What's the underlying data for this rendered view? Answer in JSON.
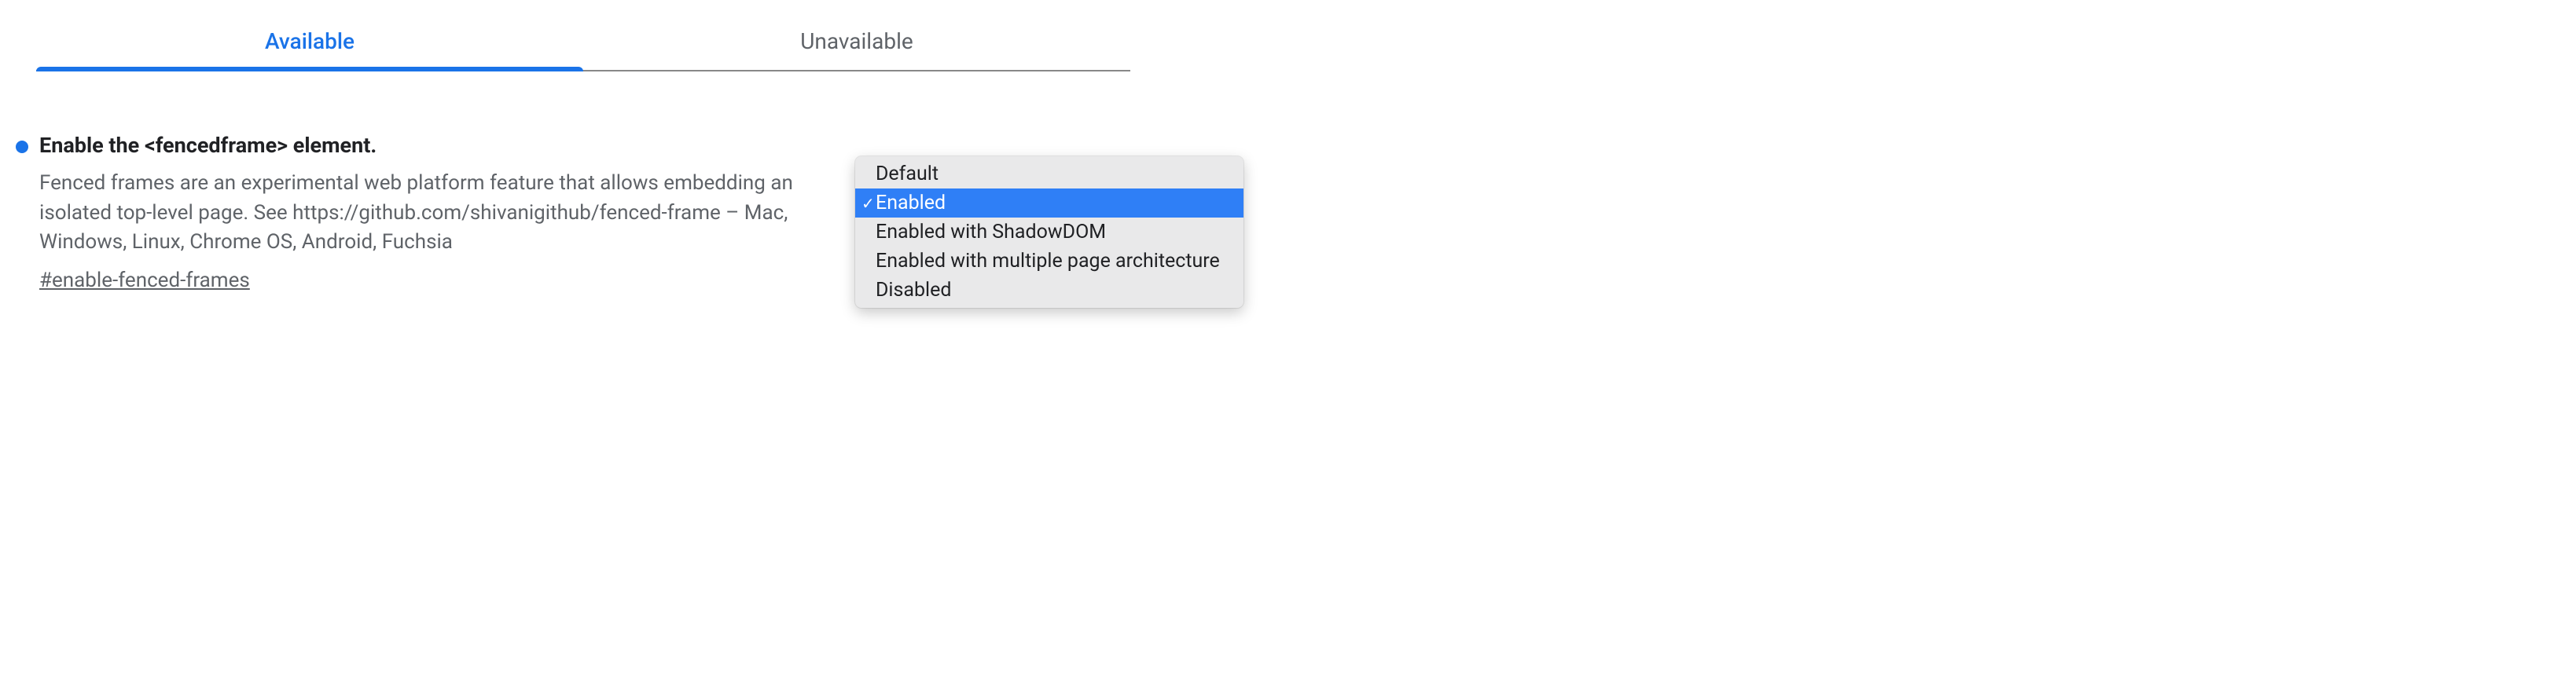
{
  "tabs": {
    "available": "Available",
    "unavailable": "Unavailable"
  },
  "flag": {
    "title": "Enable the <fencedframe> element.",
    "description": "Fenced frames are an experimental web platform feature that allows embedding an isolated top-level page. See https://github.com/shivanigithub/fenced-frame – Mac, Windows, Linux, Chrome OS, Android, Fuchsia",
    "permalink": "#enable-fenced-frames"
  },
  "dropdown": {
    "options": [
      {
        "label": "Default"
      },
      {
        "label": "Enabled"
      },
      {
        "label": "Enabled with ShadowDOM"
      },
      {
        "label": "Enabled with multiple page architecture"
      },
      {
        "label": "Disabled"
      }
    ],
    "selected_index": 1
  }
}
